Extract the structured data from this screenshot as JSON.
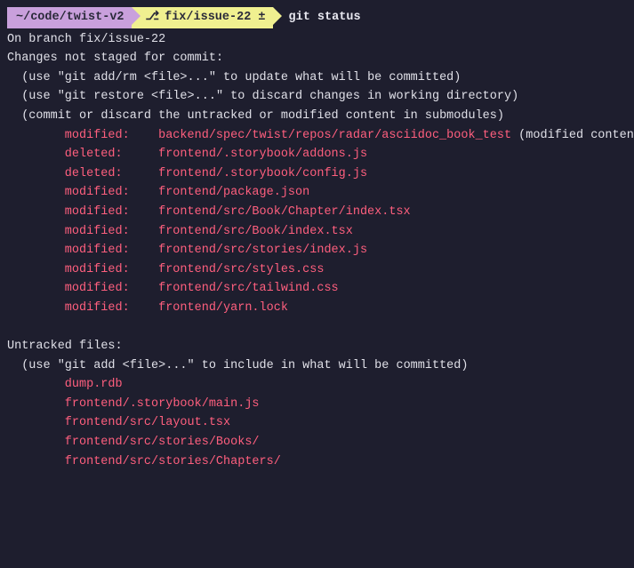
{
  "prompt": {
    "path": "~/code/twist-v2",
    "branch_icon": "⎇",
    "branch": "fix/issue-22",
    "dirty_marker": "±",
    "command": "git status"
  },
  "colors": {
    "path_bg": "#c9a0dc",
    "branch_bg": "#f0f090",
    "cmd_fg": "#e8e8f0",
    "red": "#ff5f7e",
    "bg": "#1e1e2e"
  },
  "output": {
    "on_branch": "On branch fix/issue-22",
    "not_staged_header": "Changes not staged for commit:",
    "hint_add": "  (use \"git add/rm <file>...\" to update what will be committed)",
    "hint_restore": "  (use \"git restore <file>...\" to discard changes in working directory)",
    "hint_sub": "  (commit or discard the untracked or modified content in submodules)",
    "unstaged": [
      {
        "status": "modified:",
        "path": "backend/spec/twist/repos/radar/asciidoc_book_test",
        "note": " (modified content)"
      },
      {
        "status": "deleted:",
        "path": "frontend/.storybook/addons.js"
      },
      {
        "status": "deleted:",
        "path": "frontend/.storybook/config.js"
      },
      {
        "status": "modified:",
        "path": "frontend/package.json"
      },
      {
        "status": "modified:",
        "path": "frontend/src/Book/Chapter/index.tsx"
      },
      {
        "status": "modified:",
        "path": "frontend/src/Book/index.tsx"
      },
      {
        "status": "modified:",
        "path": "frontend/src/stories/index.js"
      },
      {
        "status": "modified:",
        "path": "frontend/src/styles.css"
      },
      {
        "status": "modified:",
        "path": "frontend/src/tailwind.css"
      },
      {
        "status": "modified:",
        "path": "frontend/yarn.lock"
      }
    ],
    "untracked_header": "Untracked files:",
    "hint_untracked": "  (use \"git add <file>...\" to include in what will be committed)",
    "untracked": [
      "dump.rdb",
      "frontend/.storybook/main.js",
      "frontend/src/layout.tsx",
      "frontend/src/stories/Books/",
      "frontend/src/stories/Chapters/"
    ]
  }
}
